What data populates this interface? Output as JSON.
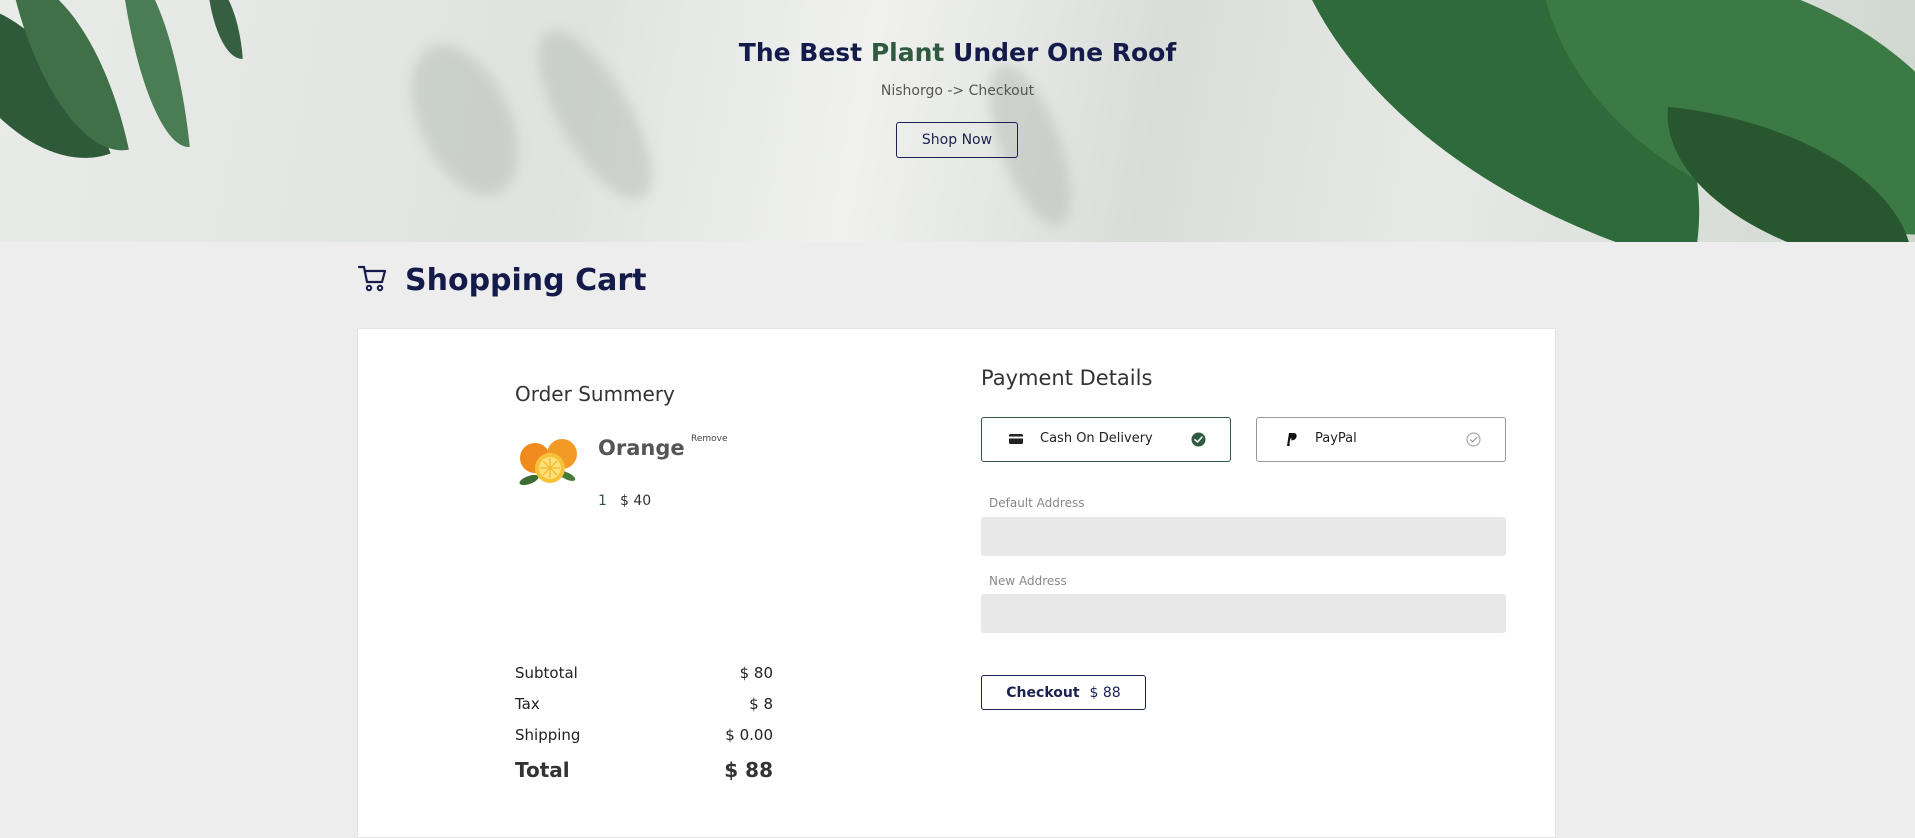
{
  "hero": {
    "title_part1": "The Best ",
    "title_accent": "Plant",
    "title_part2": " Under One Roof",
    "breadcrumb": "Nishorgo -> Checkout",
    "shop_button": "Shop Now"
  },
  "cart": {
    "heading": "Shopping Cart",
    "icon": "cart-icon"
  },
  "order": {
    "title": "Order Summery",
    "items": [
      {
        "name": "Orange",
        "remove_label": "Remove",
        "quantity": "1",
        "price": "$ 40"
      }
    ],
    "summary": [
      {
        "label": "Subtotal",
        "value": "$ 80"
      },
      {
        "label": "Tax",
        "value": "$ 8"
      },
      {
        "label": "Shipping",
        "value": "$ 0.00"
      }
    ],
    "total": {
      "label": "Total",
      "value": "$ 88"
    }
  },
  "payment": {
    "title": "Payment Details",
    "options": [
      {
        "label": "Cash On Delivery",
        "icon": "card-icon",
        "selected": true
      },
      {
        "label": "PayPal",
        "icon": "paypal-icon",
        "selected": false
      }
    ],
    "fields": [
      {
        "label": "Default Address",
        "value": ""
      },
      {
        "label": "New Address",
        "value": ""
      }
    ],
    "checkout_label": "Checkout",
    "checkout_amount": "$ 88"
  },
  "colors": {
    "navy": "#141a4a",
    "green": "#2f5a40",
    "page_bg": "#ededed"
  }
}
